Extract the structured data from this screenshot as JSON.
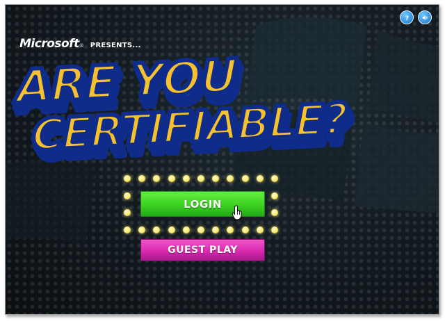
{
  "brand": {
    "company": "Microsoft",
    "trademark": "®",
    "presents": "PRESENTS..."
  },
  "title": {
    "line1": "ARE YOU",
    "line2": "CERTIFIABLE?"
  },
  "buttons": {
    "login": "LOGIN",
    "guest": "GUEST PLAY"
  },
  "icons": {
    "help": "help-icon",
    "sound": "speaker-icon",
    "pointer": "hand-cursor-icon"
  },
  "colors": {
    "title_fill": "#f7c12e",
    "title_outline": "#0f2c8a",
    "title_band_blue": "#1ea6df",
    "title_band_pink": "#e1329f",
    "login_green": "#3fd523",
    "guest_pink": "#d92ab0",
    "bulb_yellow": "#f7ea6a"
  }
}
